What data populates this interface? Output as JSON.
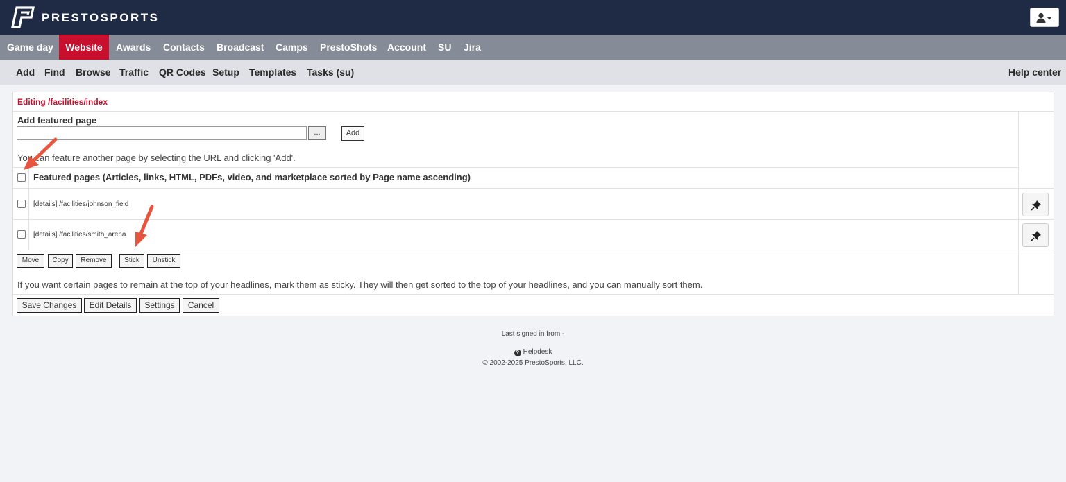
{
  "brand": {
    "name": "PRESTOSPORTS",
    "logo_icon": "prestosports-logo-icon"
  },
  "user_menu": {
    "icon": "user-icon"
  },
  "main_nav": [
    {
      "label": "Game day",
      "active": false
    },
    {
      "label": "Website",
      "active": true
    },
    {
      "label": "Awards",
      "active": false
    },
    {
      "label": "Contacts",
      "active": false
    },
    {
      "label": "Broadcast",
      "active": false
    },
    {
      "label": "Camps",
      "active": false
    },
    {
      "label": "PrestoShots",
      "active": false
    },
    {
      "label": "Account",
      "active": false
    },
    {
      "label": "SU",
      "active": false
    },
    {
      "label": "Jira",
      "active": false
    }
  ],
  "sub_nav": [
    {
      "label": "Add"
    },
    {
      "label": "Find"
    },
    {
      "label": "Browse"
    },
    {
      "label": "Traffic"
    },
    {
      "label": "QR Codes"
    },
    {
      "label": "Setup"
    },
    {
      "label": "Templates"
    },
    {
      "label": "Tasks (su)"
    }
  ],
  "help_center": "Help center",
  "editor": {
    "title": "Editing /facilities/index",
    "add_featured_label": "Add featured page",
    "url_value": "",
    "browse_label": "...",
    "add_label": "Add",
    "hint": "You can feature another page by selecting the URL and clicking 'Add'.",
    "featured_header": "Featured pages (Articles, links, HTML, PDFs, video, and marketplace sorted by Page name ascending)",
    "rows": [
      {
        "details": "[details]",
        "path": "/facilities/johnson_field"
      },
      {
        "details": "[details]",
        "path": "/facilities/smith_arena"
      }
    ],
    "row_actions": {
      "move": "Move",
      "copy": "Copy",
      "remove": "Remove",
      "stick": "Stick",
      "unstick": "Unstick"
    },
    "sticky_hint": "If you want certain pages to remain at the top of your headlines, mark them as sticky. They will then get sorted to the top of your headlines, and you can manually sort them.",
    "footer_buttons": {
      "save": "Save Changes",
      "edit_details": "Edit Details",
      "settings": "Settings",
      "cancel": "Cancel"
    }
  },
  "footer": {
    "last_signed": "Last signed in from -",
    "helpdesk": "Helpdesk",
    "copyright": "© 2002-2025 PrestoSports, LLC."
  },
  "colors": {
    "topbar": "#1f2a44",
    "active_tab": "#c8102e",
    "main_nav": "#858b97",
    "sub_nav": "#dfe1e6",
    "annotation_arrow": "#e8553f"
  }
}
